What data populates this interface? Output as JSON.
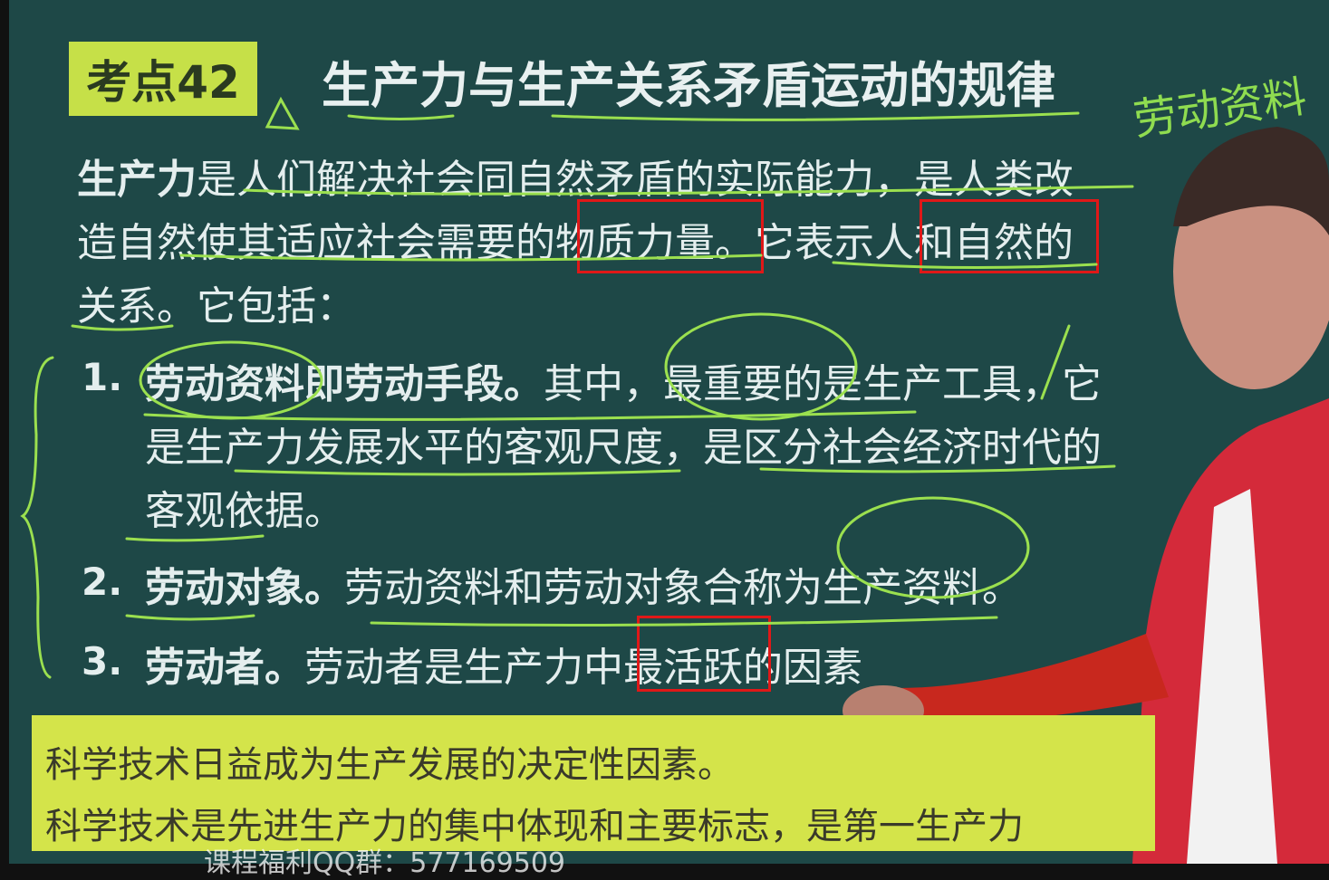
{
  "badge": "考点42",
  "title": "生产力与生产关系矛盾运动的规律",
  "intro": {
    "line1_bold": "生产力",
    "line1_rest": "是人们解决社会同自然矛盾的实际能力，是人类改",
    "line2": "造自然使其适应社会需要的物质力量。它表示人和自然的",
    "line3": "关系。它包括："
  },
  "items": [
    {
      "num": "1.",
      "bold": "劳动资料即劳动手段。",
      "rest": "其中，最重要的是生产工具，它",
      "line2": "是生产力发展水平的客观尺度，是区分社会经济时代的",
      "line3": "客观依据。"
    },
    {
      "num": "2.",
      "bold": "劳动对象。",
      "rest": "劳动资料和劳动对象合称为生产资料。"
    },
    {
      "num": "3.",
      "bold": "劳动者。",
      "rest": "劳动者是生产力中最活跃的因素"
    }
  ],
  "summary": {
    "line1": "科学技术日益成为生产发展的决定性因素。",
    "line2": "科学技术是先进生产力的集中体现和主要标志，是第一生产力"
  },
  "handwriting": "劳动资料",
  "watermark": "课程福利QQ群：577169509",
  "colors": {
    "board": "#1e4847",
    "highlight": "#d4e44a",
    "annotation": "#8fdc50",
    "box": "#e01818"
  }
}
